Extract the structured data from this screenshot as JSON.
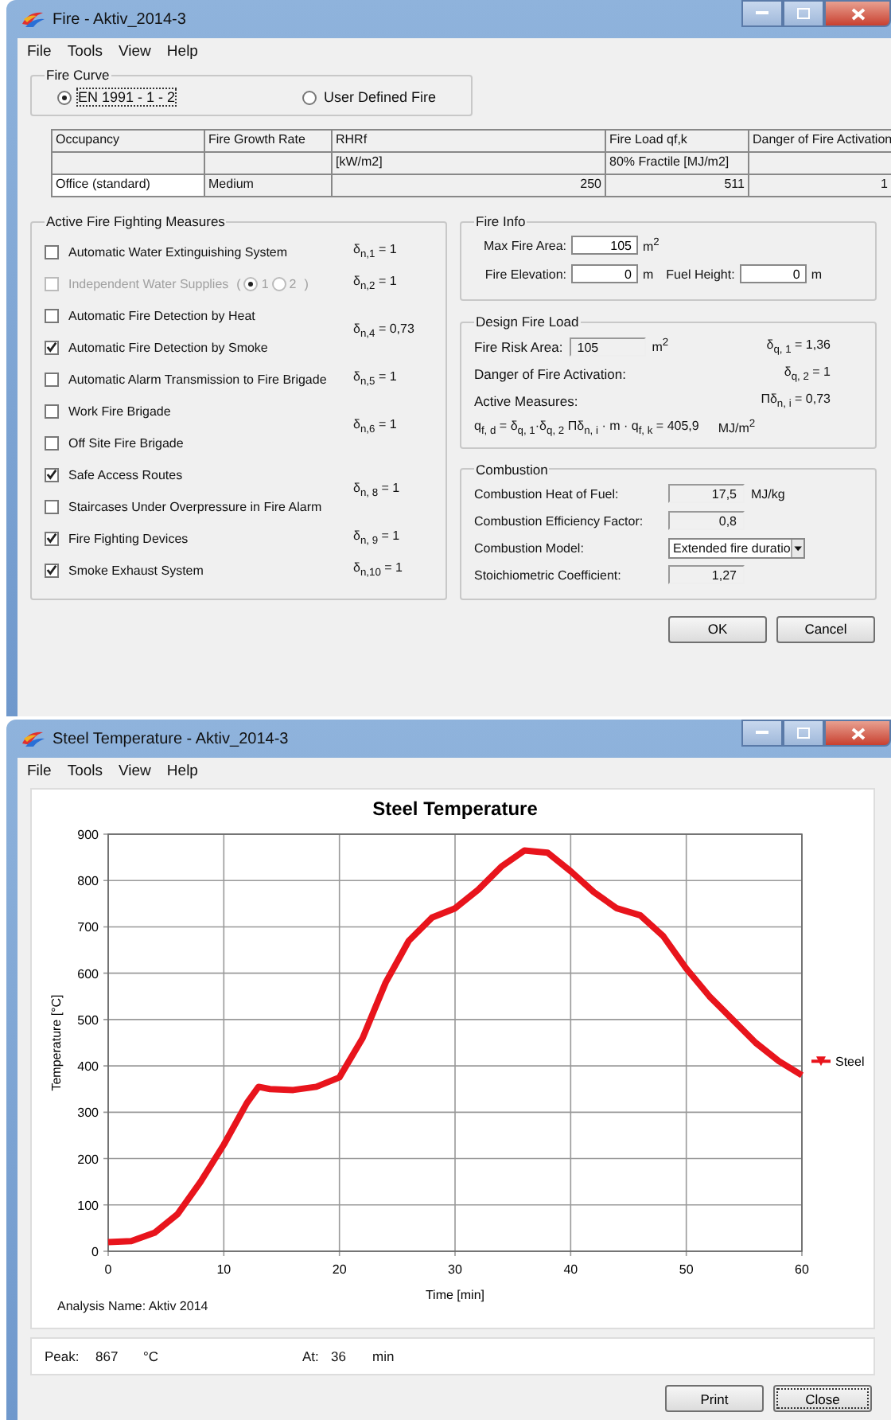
{
  "fire_window": {
    "title": "Fire - Aktiv_2014-3",
    "menu": [
      "File",
      "Tools",
      "View",
      "Help"
    ],
    "fire_curve": {
      "title": "Fire Curve",
      "options": [
        {
          "label": "EN 1991 - 1 - 2",
          "selected": true
        },
        {
          "label": "User Defined Fire",
          "selected": false
        }
      ]
    },
    "table": {
      "columns": [
        {
          "header": "Occupancy"
        },
        {
          "header": "Fire Growth Rate"
        },
        {
          "header": "RHRf",
          "unit": "[kW/m2]"
        },
        {
          "header": "Fire Load qf,k",
          "unit": "80% Fractile [MJ/m2]"
        },
        {
          "header": "Danger of Fire Activation"
        }
      ],
      "rows": [
        [
          "Office (standard)",
          "Medium",
          "250",
          "511",
          "1"
        ]
      ]
    },
    "measures": {
      "title": "Active Fire Fighting Measures",
      "groups": [
        {
          "factor": "δ$_{n,1}$ = 1",
          "items": [
            {
              "label": "Automatic Water Extinguishing System",
              "checked": false,
              "disabled": false
            }
          ]
        },
        {
          "factor": "δ$_{n,2}$ = 1",
          "items": [
            {
              "label": "Independent Water Supplies",
              "checked": false,
              "disabled": true,
              "options_open": "(",
              "options_close": ")",
              "options": [
                {
                  "label": "1",
                  "selected": true
                },
                {
                  "label": "2",
                  "selected": false
                }
              ]
            }
          ]
        },
        {
          "factor": "δ$_{n,4}$ = 0,73",
          "items": [
            {
              "label": "Automatic Fire Detection by Heat",
              "checked": false,
              "disabled": false
            },
            {
              "label": "Automatic Fire Detection by Smoke",
              "checked": true,
              "disabled": false
            }
          ]
        },
        {
          "factor": "δ$_{n,5}$ = 1",
          "items": [
            {
              "label": "Automatic Alarm Transmission to Fire Brigade",
              "checked": false,
              "disabled": false
            }
          ]
        },
        {
          "factor": "δ$_{n,6}$ = 1",
          "items": [
            {
              "label": "Work Fire Brigade",
              "checked": false,
              "disabled": false
            },
            {
              "label": "Off Site Fire Brigade",
              "checked": false,
              "disabled": false
            }
          ]
        },
        {
          "factor": "δ$_{n, 8}$ = 1",
          "items": [
            {
              "label": "Safe Access Routes",
              "checked": true,
              "disabled": false
            },
            {
              "label": "Staircases Under Overpressure in Fire Alarm",
              "checked": false,
              "disabled": false
            }
          ]
        },
        {
          "factor": "δ$_{n, 9}$ = 1",
          "items": [
            {
              "label": "Fire Fighting Devices",
              "checked": true,
              "disabled": false
            }
          ]
        },
        {
          "factor": "δ$_{n,10}$ = 1",
          "items": [
            {
              "label": "Smoke Exhaust System",
              "checked": true,
              "disabled": false
            }
          ]
        }
      ]
    },
    "fire_info": {
      "title": "Fire Info",
      "fields": [
        {
          "label": "Max Fire Area:",
          "value": "105",
          "unit": "m$^{2}$"
        },
        {
          "label": "Fire Elevation:",
          "value": "0",
          "unit": "m"
        },
        {
          "label": "Fuel Height:",
          "value": "0",
          "unit": "m"
        }
      ]
    },
    "design_fire_load": {
      "title": "Design Fire Load",
      "rows": [
        {
          "label": "Fire Risk Area:",
          "value": "105",
          "unit": "m$^{2}$",
          "factor": "δ$_{q, 1}$ = 1,36"
        },
        {
          "label": "Danger of Fire Activation:",
          "factor": "δ$_{q, 2}$ = 1"
        },
        {
          "label": "Active Measures:",
          "factor": "Πδ$_{n, i}$ = 0,73"
        }
      ],
      "result": {
        "formula": "q$_{f, d}$ = δ$_{q, 1}$·δ$_{q, 2}$ Πδ$_{n, i}$ · m · q$_{f, k}$ = 405,9",
        "unit": "MJ/m$^{2}$"
      }
    },
    "combustion": {
      "title": "Combustion",
      "fields": [
        {
          "label": "Combustion Heat of Fuel:",
          "value": "17,5",
          "unit": "MJ/kg",
          "kind": "readonly"
        },
        {
          "label": "Combustion Efficiency Factor:",
          "value": "0,8",
          "kind": "readonly"
        },
        {
          "label": "Combustion Model:",
          "value": "Extended fire duratio",
          "kind": "dropdown"
        },
        {
          "label": "Stoichiometric Coefficient:",
          "value": "1,27",
          "kind": "readonly"
        }
      ]
    },
    "buttons": [
      "OK",
      "Cancel"
    ]
  },
  "steel_window": {
    "title": "Steel Temperature - Aktiv_2014-3",
    "menu": [
      "File",
      "Tools",
      "View",
      "Help"
    ],
    "chart_data": {
      "type": "line",
      "title": "Steel Temperature",
      "xlabel": "Time [min]",
      "ylabel": "Temperature [°C]",
      "x": [
        0,
        2,
        4,
        6,
        8,
        10,
        12,
        13,
        14,
        16,
        18,
        20,
        22,
        24,
        26,
        28,
        30,
        32,
        34,
        36,
        38,
        40,
        42,
        44,
        46,
        48,
        50,
        52,
        54,
        56,
        58,
        60
      ],
      "series": [
        {
          "name": "Steel",
          "color": "#e8141c",
          "values": [
            20,
            22,
            40,
            80,
            150,
            230,
            320,
            355,
            350,
            348,
            355,
            375,
            460,
            580,
            670,
            720,
            740,
            780,
            830,
            865,
            860,
            820,
            775,
            740,
            725,
            680,
            610,
            550,
            500,
            450,
            410,
            380
          ]
        }
      ],
      "grid": true,
      "xlim": [
        0,
        60
      ],
      "ylim": [
        0,
        900
      ],
      "xticks": [
        0,
        10,
        20,
        30,
        40,
        50,
        60
      ],
      "yticks": [
        0,
        100,
        200,
        300,
        400,
        500,
        600,
        700,
        800,
        900
      ]
    },
    "analysis_name": "Analysis Name: Aktiv 2014",
    "peak": {
      "label": "Peak:",
      "value": "867",
      "unit": "°C"
    },
    "at": {
      "label": "At:",
      "value": "36",
      "unit": "min"
    },
    "buttons": [
      "Print",
      "Close"
    ]
  }
}
